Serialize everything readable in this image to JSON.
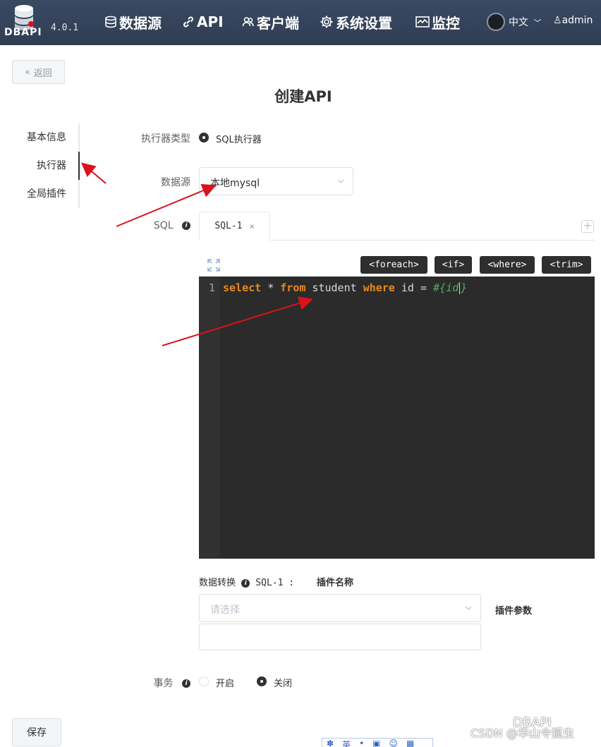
{
  "header": {
    "logo_text": "DBAPI",
    "version": "4.0.1",
    "nav": [
      "数据源",
      "API",
      "客户端",
      "系统设置",
      "监控"
    ],
    "language": "中文",
    "user": "admin"
  },
  "page": {
    "back_label": "返回",
    "title": "创建API"
  },
  "steps": [
    "基本信息",
    "执行器",
    "全局插件"
  ],
  "form": {
    "executor_type_label": "执行器类型",
    "executor_option": "SQL执行器",
    "datasource_label": "数据源",
    "datasource_value": "本地mysql",
    "sql_label": "SQL",
    "tab_label": "SQL-1",
    "tab_close": "×",
    "tab_add": "+",
    "snippets": [
      "<foreach>",
      "<if>",
      "<where>",
      "<trim>"
    ],
    "editor": {
      "line_number": "1",
      "tokens": [
        "select",
        " * ",
        "from",
        " student ",
        "where",
        " id = ",
        "#{id",
        "}"
      ]
    },
    "transform_label": "数据转换",
    "transform_sql": "SQL-1 :",
    "plugin_name_label": "插件名称",
    "plugin_placeholder": "请选择",
    "plugin_params_label": "插件参数",
    "transaction_label": "事务",
    "transaction_options": [
      "开启",
      "关闭"
    ],
    "transaction_selected": "关闭"
  },
  "save_label": "保存",
  "toolbar_glyphs": [
    "英",
    "•",
    "▣",
    "☺",
    "▦"
  ],
  "watermark": {
    "line1": "DBAPI",
    "line2": "CSDN @华山令狐虫"
  },
  "colors": {
    "header_bg": "#324157",
    "keyword": "#e8891b",
    "param": "#59a869",
    "arrow": "#d9121d"
  }
}
